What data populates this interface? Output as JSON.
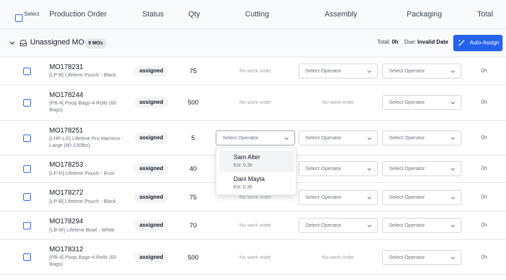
{
  "header": {
    "select_label": "Select",
    "columns": {
      "production_order": "Production Order",
      "status": "Status",
      "qty": "Qty",
      "cutting": "Cutting",
      "assembly": "Assembly",
      "packaging": "Packaging",
      "total": "Total"
    }
  },
  "group": {
    "title": "Unassigned MOs",
    "badge": "9 MOs",
    "total_label": "Total:",
    "total_value": "0h",
    "due_label": "Due:",
    "due_value": "Invalid Date",
    "auto_assign_label": "Auto-Assign"
  },
  "labels": {
    "no_work_order": "No work order",
    "select_operator": "Select Operator"
  },
  "rows": [
    {
      "mo": "MO178231",
      "desc": "[LP-B] Lifetime Pouch - Black",
      "status": "assigned",
      "qty": "75",
      "cutting": "No work order",
      "assembly": "Select Operator",
      "packaging": "Select Operator",
      "total": "0h"
    },
    {
      "mo": "MO178244",
      "desc": "[PB-4] Poop Bags-4 Rolls (60 Bags)",
      "status": "assigned",
      "qty": "500",
      "cutting": "No work order",
      "assembly": "No work order",
      "packaging": "Select Operator",
      "total": "0h"
    },
    {
      "mo": "MO178251",
      "desc": "[LHP-LG] Lifetime Pro Harness - Large (80-130lbs)",
      "status": "assigned",
      "qty": "5",
      "cutting": "Select Operator",
      "assembly": "Select Operator",
      "packaging": "Select Operator",
      "total": "0h"
    },
    {
      "mo": "MO178253",
      "desc": "[LP-R] Lifetime Pouch - Rust",
      "status": "assigned",
      "qty": "40",
      "cutting": "",
      "assembly": "Select Operator",
      "packaging": "Select Operator",
      "total": "0h"
    },
    {
      "mo": "MO178272",
      "desc": "[LP-B] Lifetime Pouch - Black",
      "status": "assigned",
      "qty": "75",
      "cutting": "No work order",
      "assembly": "Select Operator",
      "packaging": "Select Operator",
      "total": "0h"
    },
    {
      "mo": "MO178294",
      "desc": "[LB-W] Lifetime Bowl - White",
      "status": "assigned",
      "qty": "70",
      "cutting": "No work order",
      "assembly": "Select Operator",
      "packaging": "Select Operator",
      "total": "0h"
    },
    {
      "mo": "MO178312",
      "desc": "[PB-4] Poop Bags-4 Rolls (60 Bags)",
      "status": "assigned",
      "qty": "500",
      "cutting": "No work order",
      "assembly": "No work order",
      "packaging": "Select Operator",
      "total": "0h"
    }
  ],
  "dropdown": {
    "options": [
      {
        "name": "Sam Alter",
        "est": "Est: 0.3h"
      },
      {
        "name": "Dani Mayta",
        "est": "Est: 0.3h"
      }
    ]
  },
  "colors": {
    "accent": "#2563eb",
    "border": "#e5e7eb",
    "muted": "#9ca3af"
  },
  "icons": {
    "group_toggle": "chevron-down-icon",
    "group": "inbox-icon",
    "auto_assign": "wand-icon",
    "select": "chevron-down-icon"
  }
}
